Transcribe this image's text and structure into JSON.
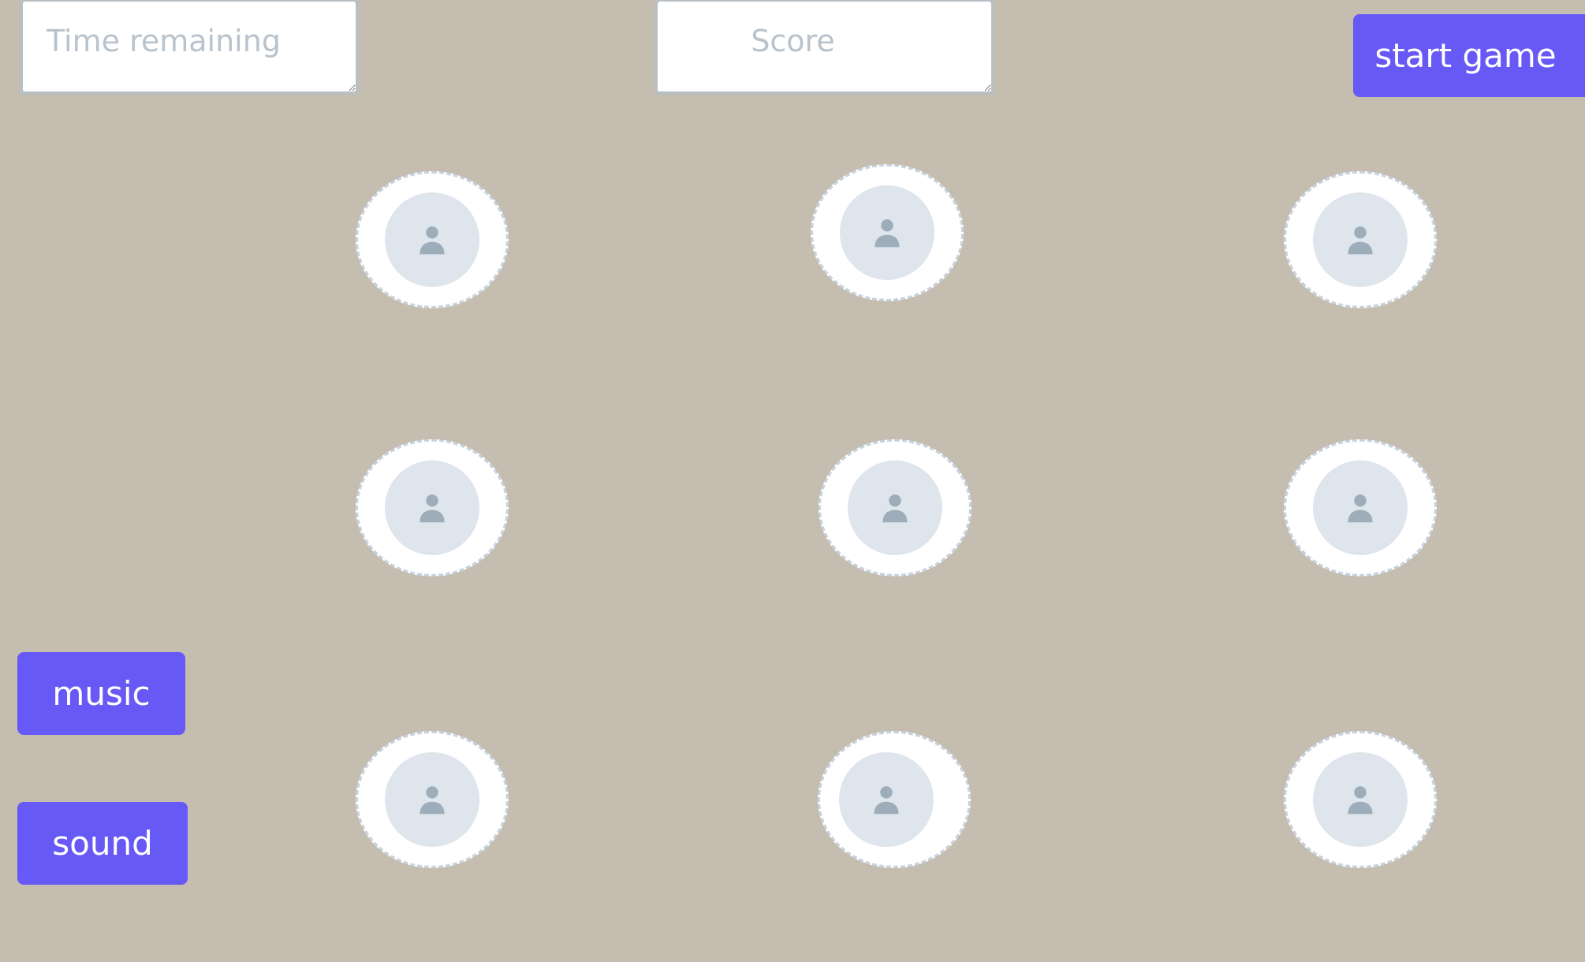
{
  "hud": {
    "time_placeholder": "Time remaining",
    "score_placeholder": "Score"
  },
  "controls": {
    "start_label": "start game",
    "music_label": "music",
    "sound_label": "sound"
  },
  "board": {
    "holes": [
      {
        "row": 1,
        "col": 1,
        "icon": "person-icon"
      },
      {
        "row": 1,
        "col": 2,
        "icon": "person-icon"
      },
      {
        "row": 1,
        "col": 3,
        "icon": "person-icon"
      },
      {
        "row": 2,
        "col": 1,
        "icon": "person-icon"
      },
      {
        "row": 2,
        "col": 2,
        "icon": "person-icon"
      },
      {
        "row": 2,
        "col": 3,
        "icon": "person-icon"
      },
      {
        "row": 3,
        "col": 1,
        "icon": "person-icon"
      },
      {
        "row": 3,
        "col": 2,
        "icon": "person-icon"
      },
      {
        "row": 3,
        "col": 3,
        "icon": "person-icon"
      }
    ]
  },
  "colors": {
    "background": "#c4bdb0",
    "button": "#6759f5",
    "button_text": "#ffffff",
    "hole_fill": "#ffffff",
    "hole_border": "#c9d3de",
    "avatar_fill": "#dfe5ec",
    "avatar_icon": "#9eadba",
    "placeholder_text": "#b9c3cd"
  }
}
